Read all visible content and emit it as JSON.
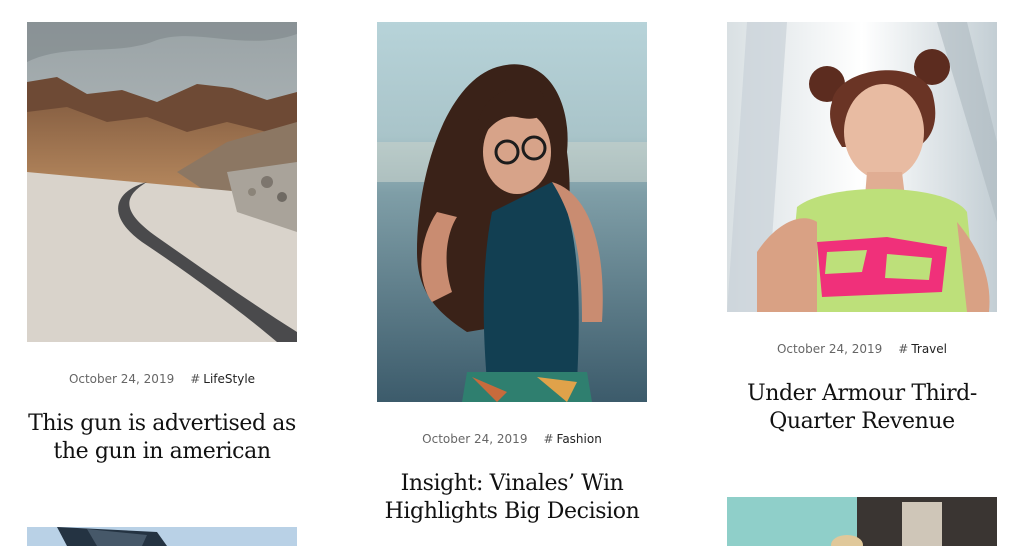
{
  "posts": [
    {
      "date": "October 24, 2019",
      "hash": "#",
      "category": "LifeStyle",
      "title_line1": "This gun is advertised as",
      "title_line2": "the gun in american"
    },
    {
      "date": "October 24, 2019",
      "hash": "#",
      "category": "Fashion",
      "title_line1": "Insight: Vinales’ Win",
      "title_line2": "Highlights Big Decision"
    },
    {
      "date": "October 24, 2019",
      "hash": "#",
      "category": "Travel",
      "title_line1": "Under Armour Third-",
      "title_line2": "Quarter Revenue"
    }
  ],
  "colors": {
    "meta_text": "#666666",
    "title_text": "#111111"
  }
}
